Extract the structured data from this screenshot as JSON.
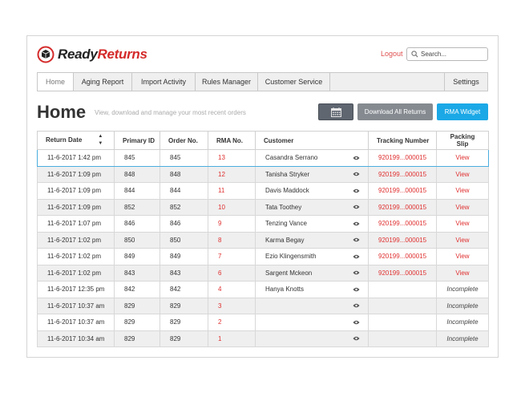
{
  "brand": {
    "ready": "Ready",
    "returns": "Returns",
    "accent": "#d42a2a"
  },
  "header": {
    "logout": "Logout",
    "search_placeholder": "Search..."
  },
  "tabs": [
    "Home",
    "Aging Report",
    "Import Activity",
    "Rules Manager",
    "Customer Service",
    "Settings"
  ],
  "page": {
    "title": "Home",
    "subtitle": "View, download and manage your most recent orders",
    "calendar_icon": "calendar-icon",
    "download_all": "Download All Returns",
    "rma_widget": "RMA Widget"
  },
  "table": {
    "headers": [
      "Return Date",
      "Primary ID",
      "Order No.",
      "RMA No.",
      "Customer",
      "Tracking Number",
      "Packing Slip"
    ],
    "rows": [
      [
        "11-6-2017 1:42 pm",
        "845",
        "845",
        "13",
        "Casandra Serrano",
        "920199...000015",
        "View"
      ],
      [
        "11-6-2017 1:09 pm",
        "848",
        "848",
        "12",
        "Tanisha Stryker",
        "920199...000015",
        "View"
      ],
      [
        "11-6-2017 1:09 pm",
        "844",
        "844",
        "11",
        "Davis Maddock",
        "920199...000015",
        "View"
      ],
      [
        "11-6-2017 1:09 pm",
        "852",
        "852",
        "10",
        "Tata Toothey",
        "920199...000015",
        "View"
      ],
      [
        "11-6-2017 1:07 pm",
        "846",
        "846",
        "9",
        "Tenzing Vance",
        "920199...000015",
        "View"
      ],
      [
        "11-6-2017 1:02 pm",
        "850",
        "850",
        "8",
        "Karma Begay",
        "920199...000015",
        "View"
      ],
      [
        "11-6-2017 1:02 pm",
        "849",
        "849",
        "7",
        "Ezio Klingensmith",
        "920199...000015",
        "View"
      ],
      [
        "11-6-2017 1:02 pm",
        "843",
        "843",
        "6",
        "Sargent Mckeon",
        "920199...000015",
        "View"
      ],
      [
        "11-6-2017 12:35 pm",
        "842",
        "842",
        "4",
        "Hanya Knotts",
        "",
        "Incomplete"
      ],
      [
        "11-6-2017 10:37 am",
        "829",
        "829",
        "3",
        "",
        "",
        "Incomplete"
      ],
      [
        "11-6-2017 10:37 am",
        "829",
        "829",
        "2",
        "",
        "",
        "Incomplete"
      ],
      [
        "11-6-2017 10:34 am",
        "829",
        "829",
        "1",
        "",
        "",
        "Incomplete"
      ]
    ]
  }
}
